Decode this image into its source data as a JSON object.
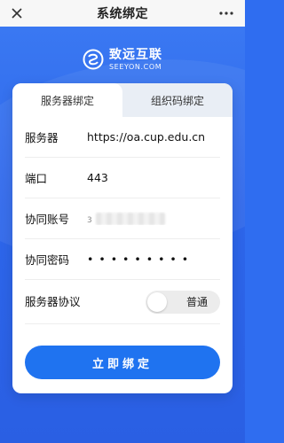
{
  "topbar": {
    "title": "系统绑定"
  },
  "logo": {
    "cn": "致远互联",
    "en": "SEEYON.COM"
  },
  "tabs": [
    {
      "label": "服务器绑定",
      "active": true
    },
    {
      "label": "组织码绑定",
      "active": false
    }
  ],
  "form": {
    "server": {
      "label": "服务器",
      "value": "https://oa.cup.edu.cn"
    },
    "port": {
      "label": "端口",
      "value": "443"
    },
    "account": {
      "label": "协同账号",
      "value": "3"
    },
    "password": {
      "label": "协同密码",
      "value": "• • • • • • • • •"
    },
    "protocol": {
      "label": "服务器协议",
      "value": "普通"
    }
  },
  "submit": {
    "label": "立即绑定"
  },
  "colors": {
    "primary": "#1f73f0",
    "background": "#2f6df0"
  }
}
